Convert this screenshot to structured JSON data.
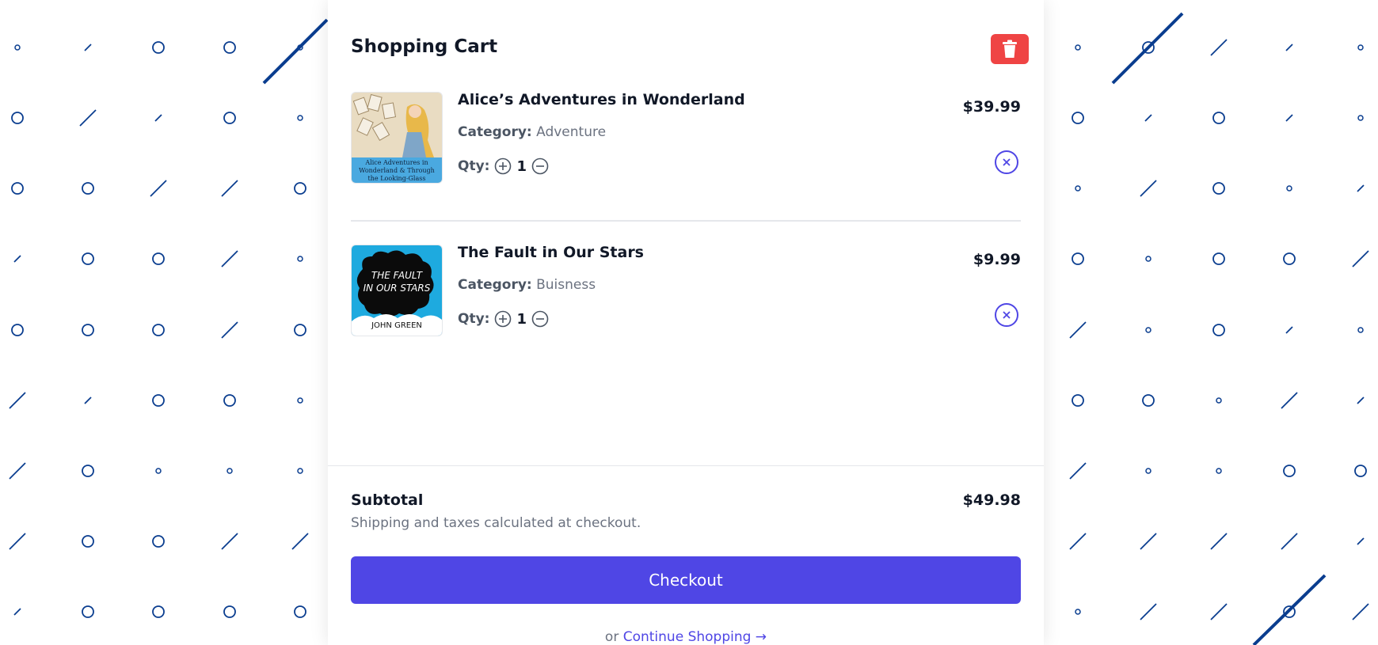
{
  "background": {
    "pattern_color": "#0a3d8f"
  },
  "cart": {
    "title": "Shopping Cart",
    "clear_icon": "trash-icon",
    "items": [
      {
        "name": "Alice’s Adventures in Wonderland",
        "category_label": "Category:",
        "category": "Adventure",
        "qty_label": "Qty:",
        "qty": "1",
        "price": "$39.99",
        "cover_text": [
          "Alice Adventures in",
          "Wonderland & Through",
          "the Looking-Glass"
        ]
      },
      {
        "name": "The Fault in Our Stars",
        "category_label": "Category:",
        "category": "Buisness",
        "qty_label": "Qty:",
        "qty": "1",
        "price": "$9.99",
        "cover_text": [
          "THE FAULT",
          "IN OUR STARS",
          "JOHN GREEN"
        ]
      }
    ],
    "subtotal_label": "Subtotal",
    "subtotal": "$49.98",
    "note": "Shipping and taxes calculated at checkout.",
    "checkout_label": "Checkout",
    "or_text": "or",
    "continue_label": "Continue Shopping →"
  },
  "colors": {
    "accent": "#4f46e5",
    "danger": "#ef4444"
  }
}
